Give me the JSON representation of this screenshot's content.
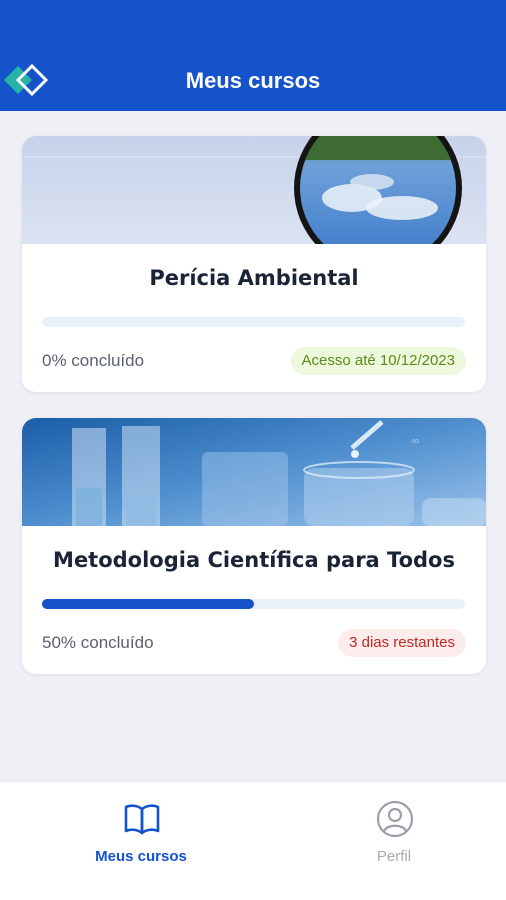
{
  "header": {
    "title": "Meus cursos",
    "logo_icon": "diamond-logo-icon"
  },
  "courses": [
    {
      "title": "Perícia Ambiental",
      "image_icon": "magnifying-glass-image",
      "progress_fraction": 0.0,
      "progress_label": "0% concluído",
      "badge": "Acesso até 10/12/2023",
      "badge_color": "#5c8a1a"
    },
    {
      "title": "Metodologia Científica para Todos",
      "image_icon": "laboratory-glassware-image",
      "progress_fraction": 0.5,
      "progress_label": "50% concluído",
      "badge": "3 dias restantes",
      "badge_color": "#c02828"
    }
  ],
  "bottom_nav": {
    "courses_label": "Meus cursos",
    "profile_label": "Perfil",
    "courses_icon": "open-book-icon",
    "profile_icon": "user-circle-icon"
  },
  "colors": {
    "primary": "#1453c9",
    "background": "#eef0f5"
  }
}
